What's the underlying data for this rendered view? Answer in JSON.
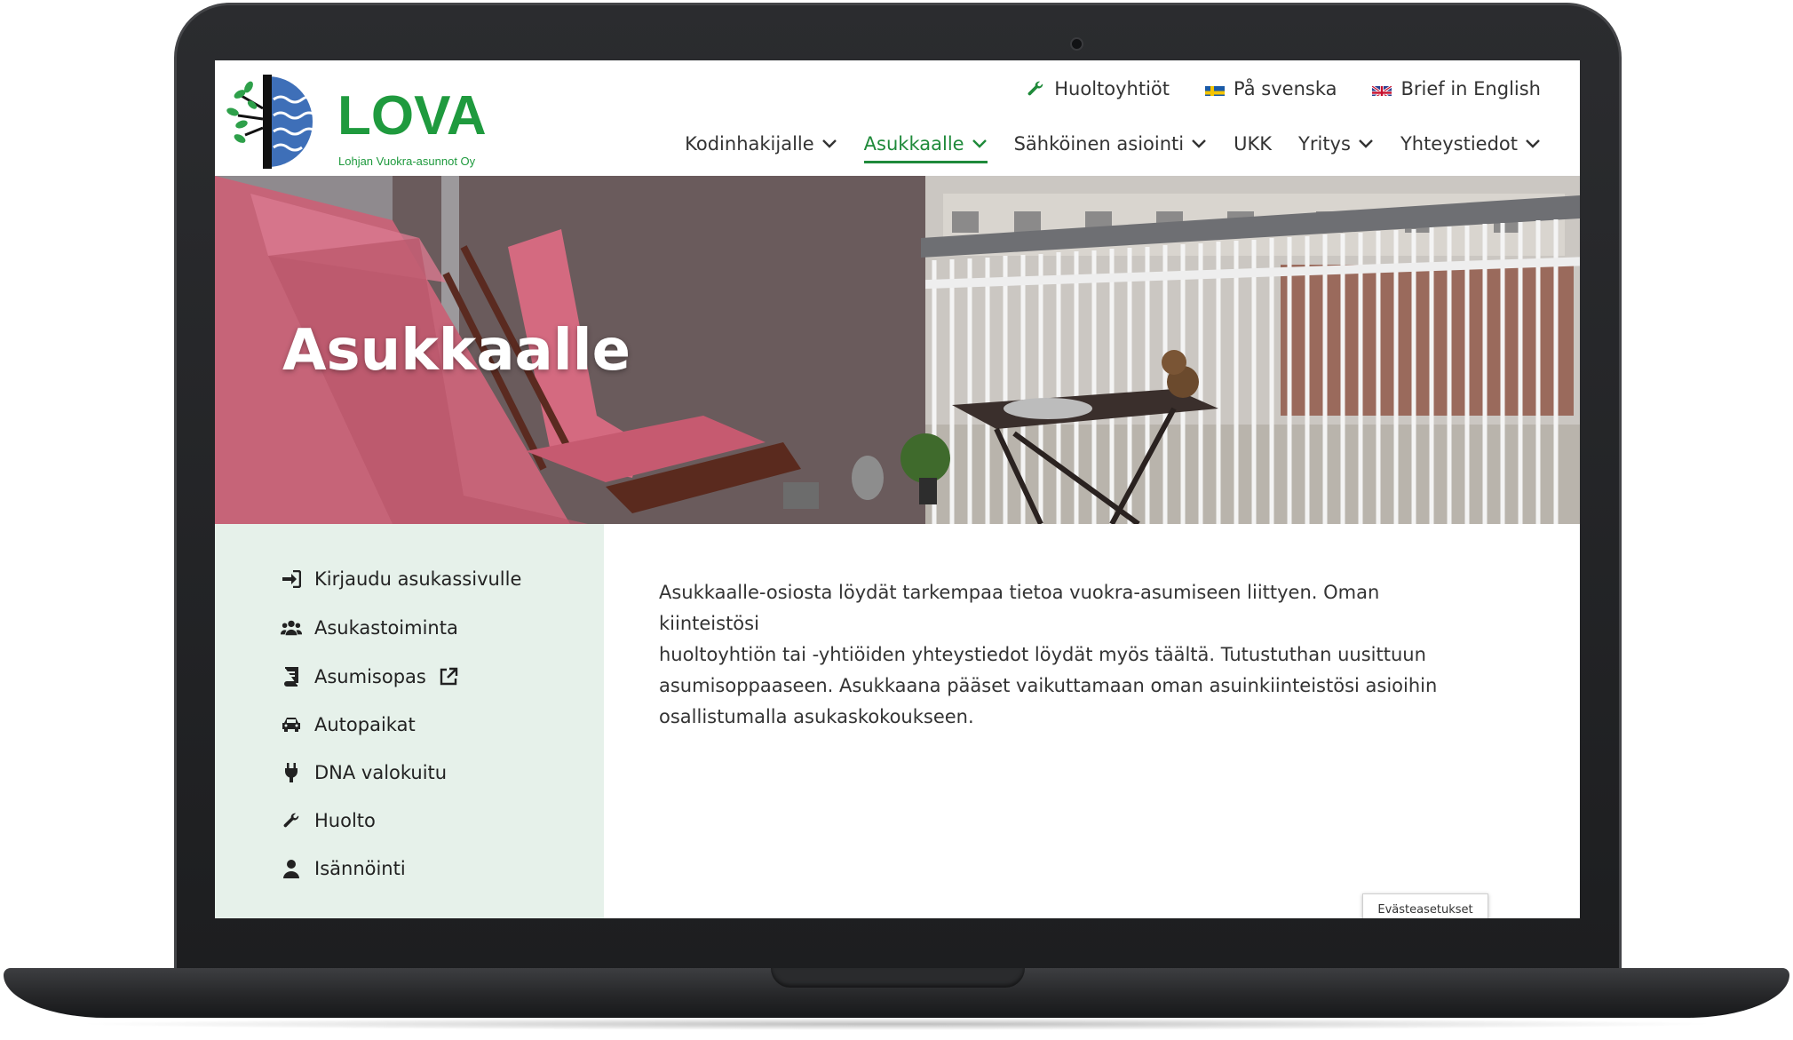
{
  "brand": {
    "name": "LOVA",
    "subtitle": "Lohjan Vuokra-asunnot Oy",
    "color": "#1f9a3e"
  },
  "topbar": {
    "items": [
      {
        "label": "Huoltoyhtiöt",
        "icon": "wrench-icon"
      },
      {
        "label": "På svenska",
        "icon": "swedish-flag-icon"
      },
      {
        "label": "Brief in English",
        "icon": "uk-flag-icon"
      }
    ]
  },
  "nav": {
    "items": [
      {
        "label": "Kodinhakijalle",
        "dropdown": true,
        "active": false
      },
      {
        "label": "Asukkaalle",
        "dropdown": true,
        "active": true
      },
      {
        "label": "Sähköinen asiointi",
        "dropdown": true,
        "active": false
      },
      {
        "label": "UKK",
        "dropdown": false,
        "active": false
      },
      {
        "label": "Yritys",
        "dropdown": true,
        "active": false
      },
      {
        "label": "Yhteystiedot",
        "dropdown": true,
        "active": false
      }
    ],
    "active_color": "#1f8a3a"
  },
  "hero": {
    "title": "Asukkaalle"
  },
  "sidebar": {
    "items": [
      {
        "label": "Kirjaudu asukassivulle",
        "icon": "sign-in-icon"
      },
      {
        "label": "Asukastoiminta",
        "icon": "users-icon"
      },
      {
        "label": "Asumisopas",
        "icon": "book-icon",
        "external": true
      },
      {
        "label": "Autopaikat",
        "icon": "car-icon"
      },
      {
        "label": "DNA valokuitu",
        "icon": "plug-icon"
      },
      {
        "label": "Huolto",
        "icon": "wrench-icon"
      },
      {
        "label": "Isännöinti",
        "icon": "user-icon"
      }
    ],
    "background": "#e6f1ea"
  },
  "content": {
    "lines": [
      "Asukkaalle-osiosta löydät tarkempaa tietoa vuokra-asumiseen liittyen. Oman kiinteistösi",
      "huoltoyhtiön tai -yhtiöiden yhteystiedot löydät myös täältä. Tutustuthan uusittuun",
      "asumisoppaaseen. Asukkaana pääset vaikuttamaan oman asuinkiinteistösi asioihin",
      "osallistumalla asukaskokoukseen."
    ]
  },
  "cookie_button": {
    "label": "Evästeasetukset"
  }
}
